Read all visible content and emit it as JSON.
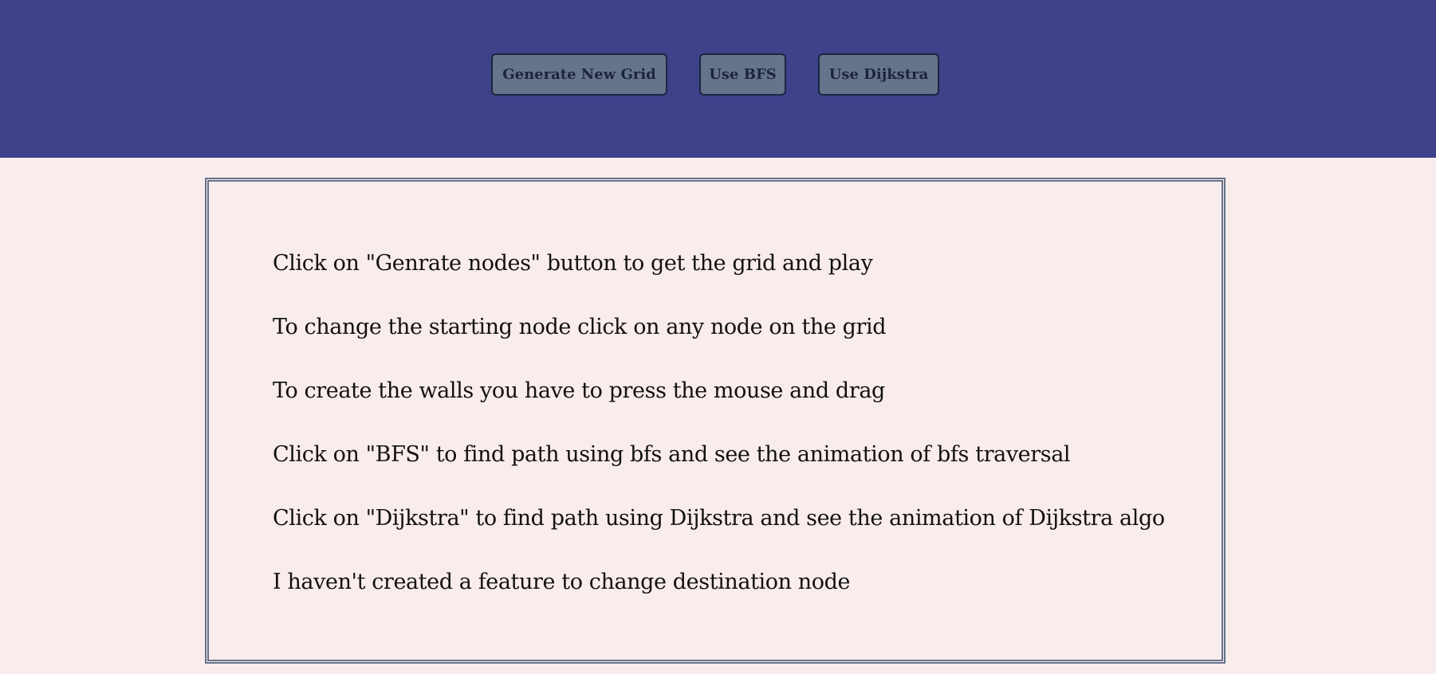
{
  "header": {
    "background": "#3f418a",
    "buttons": {
      "generate_label": "Generate New Grid",
      "bfs_label": "Use BFS",
      "dijkstra_label": "Use Dijkstra"
    },
    "button_color": "#65738b"
  },
  "panel": {
    "border_color": "#66738b",
    "instructions": [
      "Click on \"Genrate nodes\" button to get the grid and play",
      "To change the starting node click on any node on the grid",
      "To create the walls you have to press the mouse and drag",
      "Click on \"BFS\" to find path using bfs and see the animation of bfs traversal",
      "Click on \"Dijkstra\" to find path using Dijkstra and see the animation of Dijkstra algo",
      "I haven't created a feature to change destination node"
    ]
  },
  "page_background": "#f9ecec"
}
